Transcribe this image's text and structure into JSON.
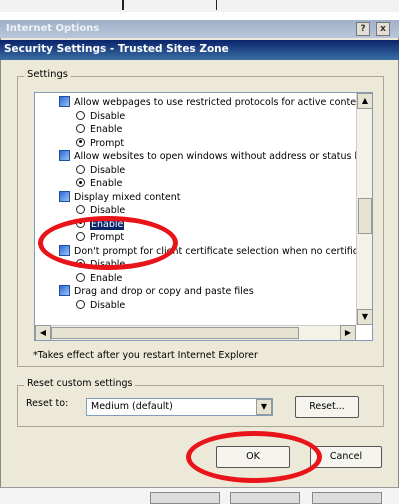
{
  "parent_window": {
    "title": "Internet Options",
    "buttons": {
      "help": "?",
      "close": "x"
    }
  },
  "dialog": {
    "title": "Security Settings - Trusted Sites Zone",
    "settings_label": "Settings",
    "items": [
      {
        "kind": "category",
        "label": "Allow webpages to use restricted protocols for active conten"
      },
      {
        "kind": "option",
        "label": "Disable",
        "selected": false
      },
      {
        "kind": "option",
        "label": "Enable",
        "selected": false
      },
      {
        "kind": "option",
        "label": "Prompt",
        "selected": true
      },
      {
        "kind": "category",
        "label": "Allow websites to open windows without address or status ba"
      },
      {
        "kind": "option",
        "label": "Disable",
        "selected": false
      },
      {
        "kind": "option",
        "label": "Enable",
        "selected": true
      },
      {
        "kind": "category",
        "label": "Display mixed content"
      },
      {
        "kind": "option",
        "label": "Disable",
        "selected": false
      },
      {
        "kind": "option",
        "label": "Enable",
        "selected": true,
        "highlighted": true
      },
      {
        "kind": "option",
        "label": "Prompt",
        "selected": false
      },
      {
        "kind": "category",
        "label": "Don't prompt for client certificate selection when no certificat"
      },
      {
        "kind": "option",
        "label": "Disable",
        "selected": true
      },
      {
        "kind": "option",
        "label": "Enable",
        "selected": false
      },
      {
        "kind": "category",
        "label": "Drag and drop or copy and paste files"
      },
      {
        "kind": "option",
        "label": "Disable",
        "selected": false
      }
    ],
    "note": "*Takes effect after you restart Internet Explorer",
    "reset_group_label": "Reset custom settings",
    "reset_to_label": "Reset to:",
    "reset_select_value": "Medium (default)",
    "reset_button": "Reset...",
    "ok_button": "OK",
    "cancel_button": "Cancel"
  },
  "colors": {
    "annotation": "#e8141a",
    "title_bar": "#0a246a",
    "selection": "#0a246a",
    "dialog_bg": "#ece9d8"
  }
}
